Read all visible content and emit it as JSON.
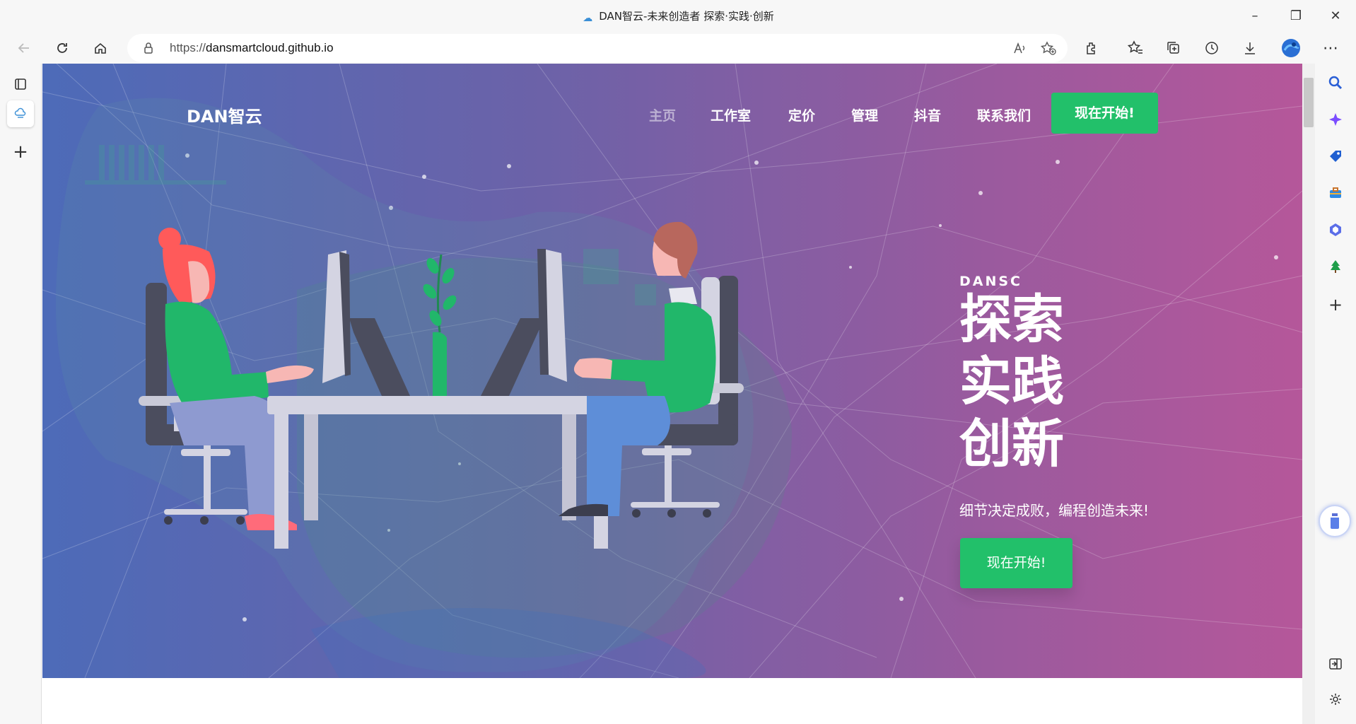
{
  "browser": {
    "window_title": "DAN智云-未来创造者 探索·实践·创新",
    "url_prefix": "https://",
    "url_host": "dansmartcloud.github.io",
    "icons": [
      "back-icon",
      "refresh-icon",
      "home-icon",
      "lock-icon",
      "read-aloud-icon",
      "add-favorite-icon",
      "extensions-icon",
      "favorites-icon",
      "collections-icon",
      "history-icon",
      "downloads-icon",
      "profile-avatar",
      "more-icon"
    ]
  },
  "page": {
    "brand": "DAN智云",
    "nav": [
      "主页",
      "工作室",
      "定价",
      "管理",
      "抖音",
      "联系我们"
    ],
    "nav_cta": "现在开始!",
    "eyebrow": "DANSC",
    "headline": [
      "探索",
      "实践",
      "创新"
    ],
    "subline": "细节决定成败，编程创造未来!",
    "hero_cta": "现在开始!",
    "colors": {
      "accent": "#22c06a",
      "gradient_left": "#4d6bb8",
      "gradient_right": "#b5579a"
    }
  }
}
